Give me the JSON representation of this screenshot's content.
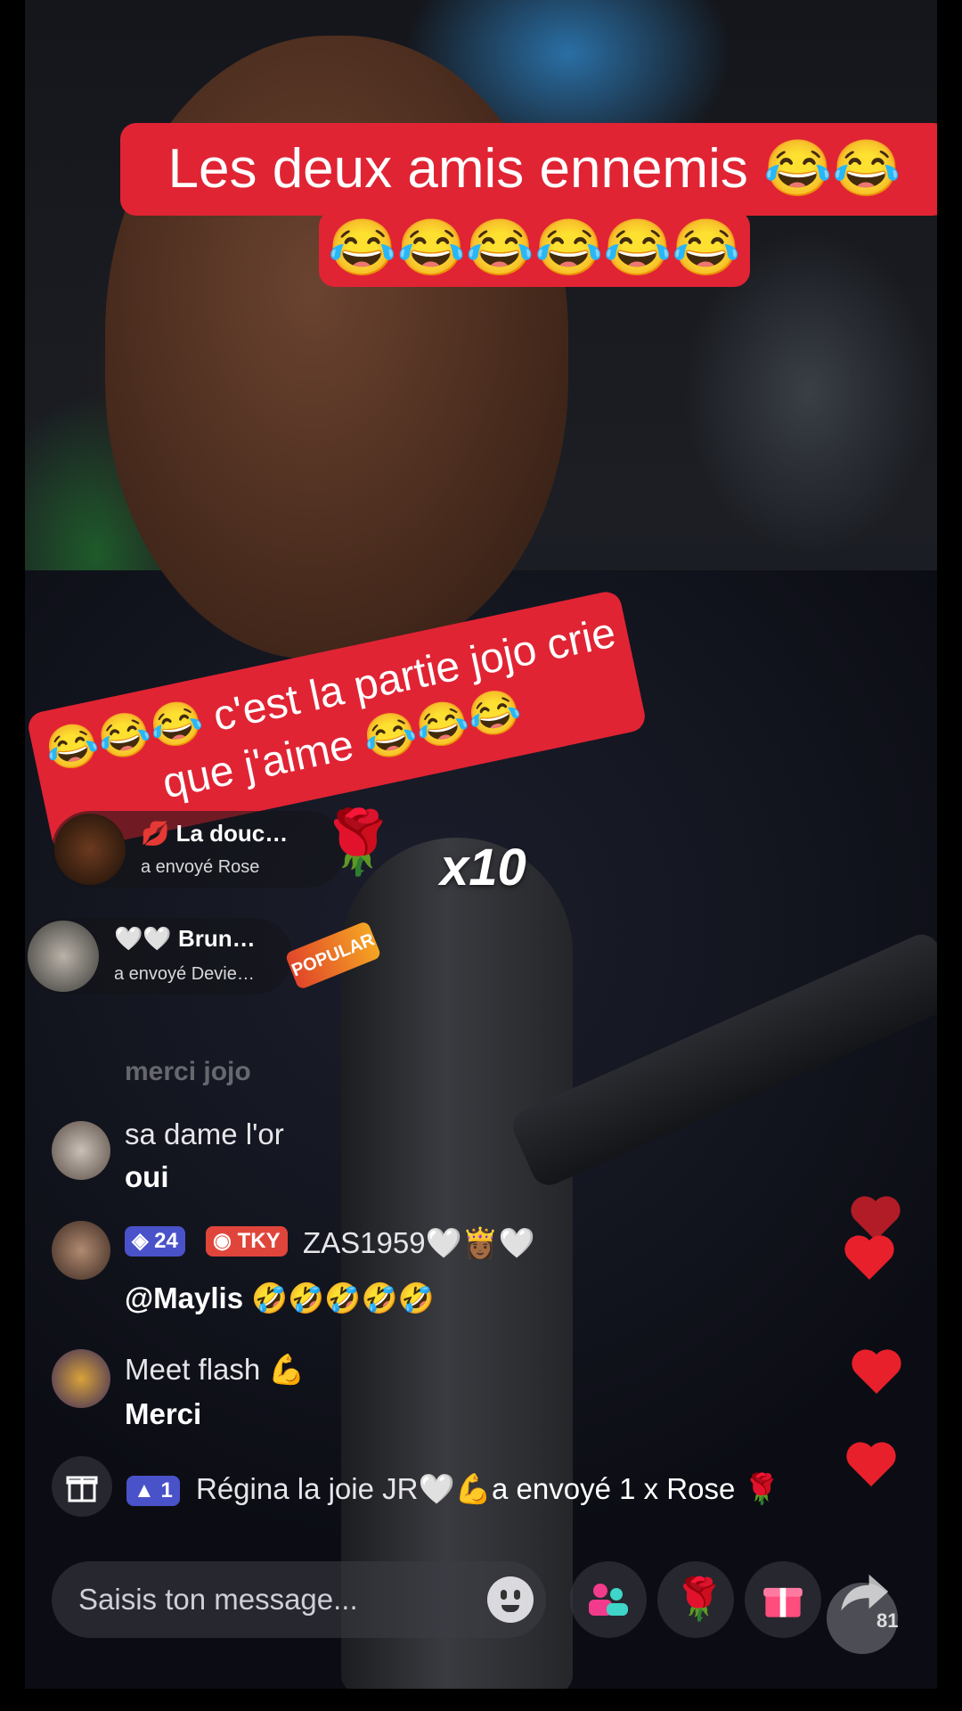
{
  "captions": {
    "top_line1": "Les deux amis ennemis 😂😂",
    "top_line2": "😂😂😂😂😂😂",
    "middle": "😂😂😂 c'est la partie jojo crie que j'aime 😂😂😂"
  },
  "gifts": [
    {
      "user": "💋 La douc…",
      "action_prefix": "a envoyé",
      "gift_name": "Rose",
      "gift_icon": "rose-icon",
      "combo": "x10"
    },
    {
      "user": "🤍🤍 Brun…",
      "action_prefix": "a envoyé",
      "gift_name": "Devie…",
      "gift_icon": "popular-badge",
      "badge_text": "POPULAR"
    }
  ],
  "comments": {
    "faded": "merci jojo",
    "items": [
      {
        "name": "sa dame l'or",
        "text": "oui"
      },
      {
        "level": "24",
        "fan_club": "TKY",
        "name": "ZAS1959🤍👸🏾🤍",
        "text": "@Maylis 🤣🤣🤣🤣🤣"
      },
      {
        "name": "Meet flash 💪",
        "text": "Merci"
      }
    ]
  },
  "gift_event": {
    "level": "1",
    "user": "Régina la joie JR🤍💪",
    "text": "a envoyé 1 x Rose 🌹"
  },
  "input": {
    "placeholder": "Saisis ton message..."
  },
  "icons": {
    "emoji": "emoji-icon",
    "multi_guest": "people-icon",
    "rose": "rose-icon",
    "gift": "gift-icon",
    "share": "share-icon"
  },
  "share_count": "81",
  "colors": {
    "caption_red": "#e02434",
    "level_badge": "#4a52c9",
    "fan_badge": "#e0453b",
    "heart": "#e8202b"
  }
}
